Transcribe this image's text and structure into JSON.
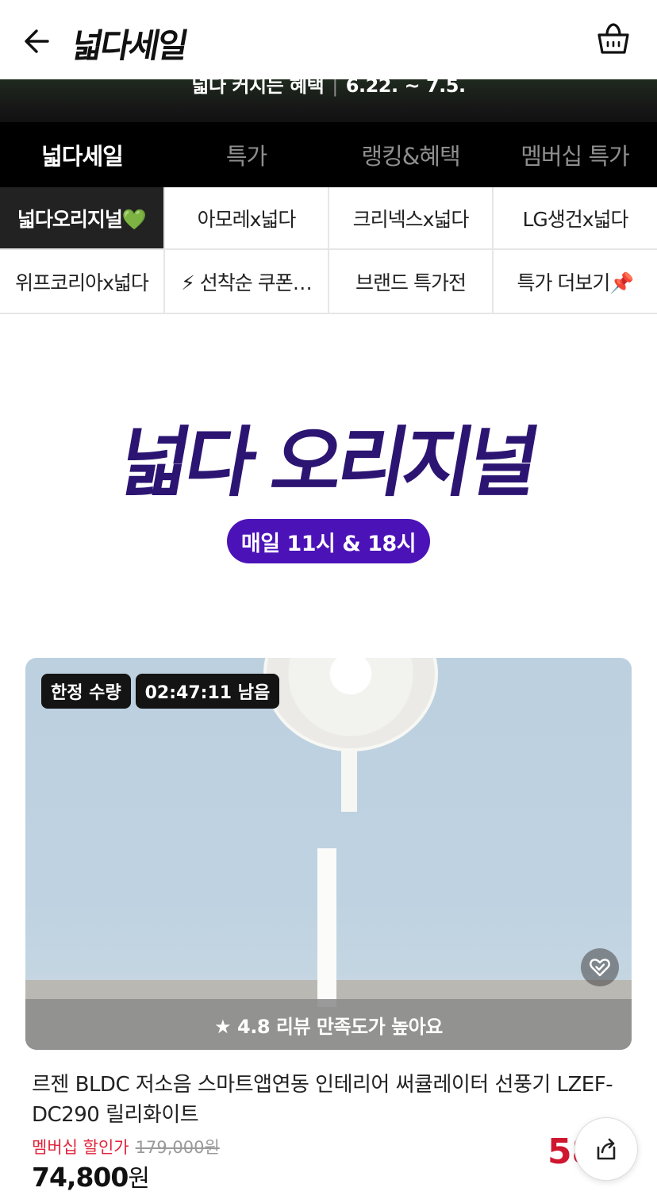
{
  "header": {
    "logo": "넓다세일",
    "back_icon": "arrow-left-icon",
    "cart_icon": "shopping-basket-icon"
  },
  "promo": {
    "text": "넓다 커지는 혜택",
    "separator": "|",
    "period": "6.22. ~ 7.5."
  },
  "tabs": [
    {
      "label": "넓다세일",
      "active": true
    },
    {
      "label": "특가",
      "active": false
    },
    {
      "label": "랭킹&혜택",
      "active": false
    },
    {
      "label": "멤버십 특가",
      "active": false
    }
  ],
  "submenu": [
    {
      "label": "넓다오리지널💚",
      "active": true
    },
    {
      "label": "아모레x넓다",
      "active": false
    },
    {
      "label": "크리넥스x넓다",
      "active": false
    },
    {
      "label": "LG생건x넓다",
      "active": false
    },
    {
      "label": "위프코리아x넓다",
      "active": false
    },
    {
      "label": "⚡ 선착순 쿠폰…",
      "active": false
    },
    {
      "label": "브랜드 특가전",
      "active": false
    },
    {
      "label": "특가 더보기📌",
      "active": false
    }
  ],
  "hero": {
    "title": "넓다 오리지널",
    "schedule": "매일 11시 & 18시"
  },
  "product": {
    "badge_limited": "한정 수량",
    "timer": "02:47:11 남음",
    "review": "★ 4.8 리뷰 만족도가 높아요",
    "name": "르젠 BLDC 저소음 스마트앱연동 인테리어 써큘레이터 선풍기 LZEF-DC290 릴리화이트",
    "member_label": "멤버십 할인가",
    "original_price": "179,000원",
    "price": "74,800",
    "currency": "원",
    "discount": "58",
    "wish_icon": "heart-check-icon",
    "share_icon": "share-icon"
  }
}
